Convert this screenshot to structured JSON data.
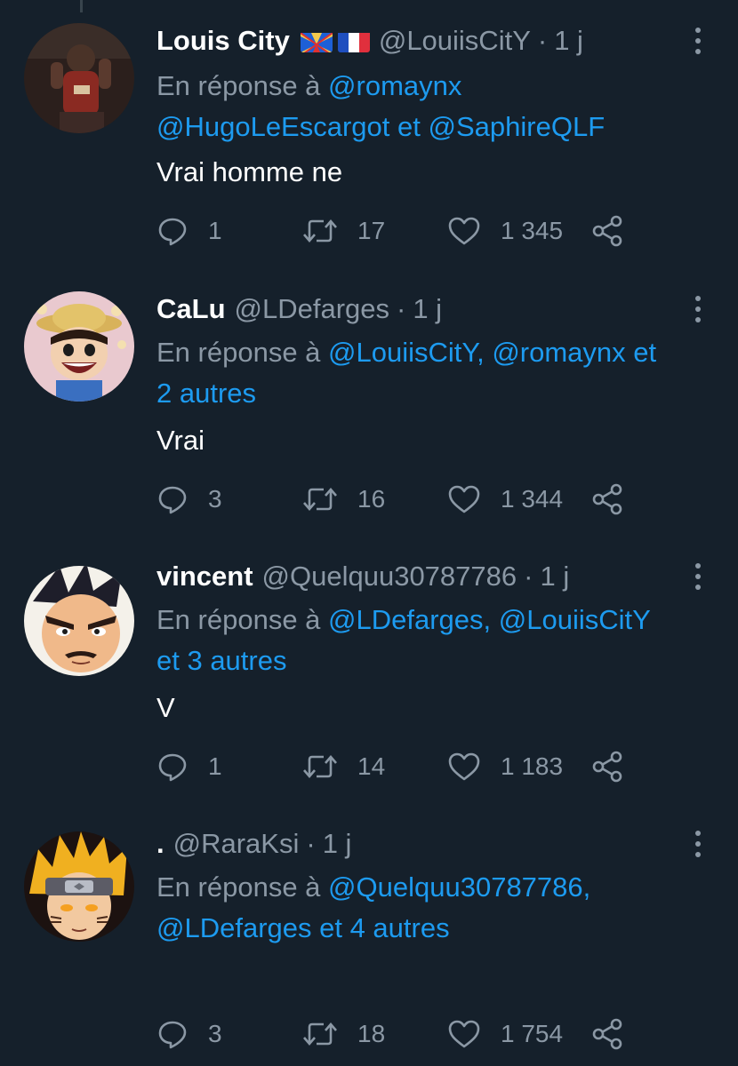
{
  "tweets": [
    {
      "name": "Louis City",
      "handle": "@LouiisCitY",
      "sep": "·",
      "time": "1 j",
      "flags": [
        "reunion-flag",
        "france-flag"
      ],
      "reply_prefix": "En réponse à",
      "reply_parts": [
        "@romaynx",
        "@HugoLeEscargot",
        "et",
        "@SaphireQLF"
      ],
      "text": "Vrai homme ne",
      "replies": "1",
      "retweets": "17",
      "likes": "1 345"
    },
    {
      "name": "CaLu",
      "handle": "@LDefarges",
      "sep": "·",
      "time": "1 j",
      "reply_prefix": "En réponse à",
      "reply_parts": [
        "@LouiisCitY,",
        "@romaynx et",
        "2 autres"
      ],
      "text": "Vrai",
      "replies": "3",
      "retweets": "16",
      "likes": "1 344"
    },
    {
      "name": "vincent",
      "handle": "@Quelquu30787786",
      "sep": "·",
      "time": "1 j",
      "reply_prefix": "En réponse à",
      "reply_parts": [
        "@LDefarges,",
        "@LouiisCitY",
        "et 3 autres"
      ],
      "text": "V",
      "replies": "1",
      "retweets": "14",
      "likes": "1 183"
    },
    {
      "name": ".",
      "handle": "@RaraKsi",
      "sep": "·",
      "time": "1 j",
      "reply_prefix": "En réponse à",
      "reply_parts": [
        "@Quelquu30787786,",
        "@LDefarges et 4 autres"
      ],
      "text": "",
      "replies": "3",
      "retweets": "18",
      "likes": "1 754"
    }
  ],
  "colors": {
    "background": "#15202b",
    "link": "#1d9bf0",
    "secondary_text": "#8b98a5",
    "primary_text": "#ffffff"
  },
  "icons": {
    "reply": "reply-icon",
    "retweet": "retweet-icon",
    "like": "like-icon",
    "share": "share-icon",
    "more": "more-options-icon"
  }
}
